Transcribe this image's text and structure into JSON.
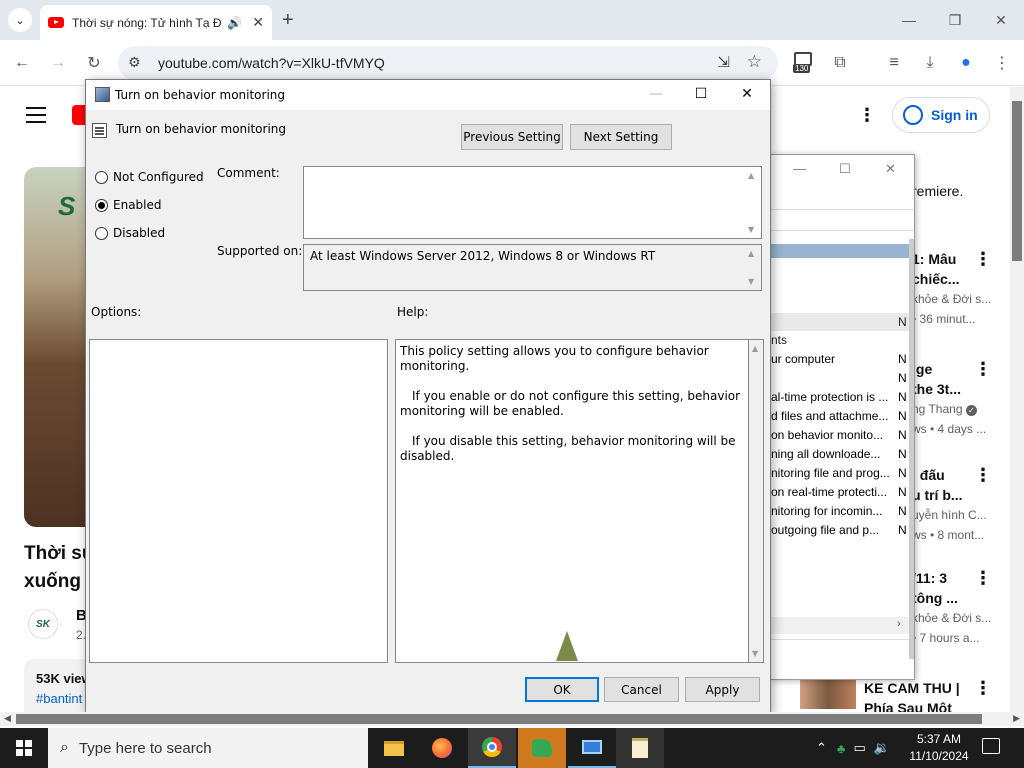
{
  "browser": {
    "tab_title": "Thời sự nóng: Tử hình Tạ Đ",
    "url": "youtube.com/watch?v=XlkU-tfVMYQ",
    "extension_badge": "130",
    "icons": [
      "chevron-down-icon",
      "youtube-favicon",
      "audio-icon",
      "close-icon",
      "plus-icon",
      "back-icon",
      "forward-icon",
      "reload-icon",
      "site-info-icon",
      "install-icon",
      "star-icon",
      "calendar-icon",
      "puzzle-icon",
      "media-icon",
      "download-icon",
      "profile-icon",
      "more-vert-icon"
    ]
  },
  "youtube": {
    "sign_in": "Sign in",
    "video_title_line1": "Thời sự",
    "video_title_line2": "xuống",
    "thumb_logo": "S",
    "channel_logo": "SK",
    "channel_initial": "B",
    "channel_sub": "2.",
    "views": "53K view",
    "hashtag": "#bantint",
    "premiere": "remiere.",
    "recs": [
      {
        "title1": "1: Mâu",
        "title2": "chiếc...",
        "meta1": "khỏe & Đời s...",
        "meta2": "• 36 minut..."
      },
      {
        "title1": "ige",
        "title2": "the 3t...",
        "meta1": "ng Thang",
        "meta2": "ws • 4 days ..."
      },
      {
        "title1": "ì đấu",
        "title2": "u trí b...",
        "meta1": "uyễn hình C...",
        "meta2": "ws • 8 mont..."
      },
      {
        "title1": "/11: 3",
        "title2": "tông ...",
        "meta1": "khỏe & Đời s...",
        "meta2": "• 7 hours a..."
      }
    ],
    "bottom_title1": "KE CAM THU |",
    "bottom_title2": "Phía Sau Một"
  },
  "gp_editor": {
    "section": "nts",
    "list": [
      {
        "text": "ur computer",
        "state": "N"
      },
      {
        "text": "",
        "state": "N"
      },
      {
        "text": "al-time protection is ...",
        "state": "N"
      },
      {
        "text": "d files and attachme...",
        "state": "N"
      },
      {
        "text": "on behavior monito...",
        "state": "N"
      },
      {
        "text": "ning all downloade...",
        "state": "N"
      },
      {
        "text": "nitoring file and prog...",
        "state": "N"
      },
      {
        "text": "on real-time protecti...",
        "state": "N"
      },
      {
        "text": "nitoring for incomin...",
        "state": "N"
      },
      {
        "text": " outgoing file and p...",
        "state": "N"
      }
    ],
    "top_state": "N"
  },
  "dialog": {
    "title": "Turn on behavior monitoring",
    "header": "Turn on behavior monitoring",
    "prev_button": "Previous Setting",
    "next_button": "Next Setting",
    "options": [
      "Not Configured",
      "Enabled",
      "Disabled"
    ],
    "selected": "Enabled",
    "comment_label": "Comment:",
    "comment_value": "",
    "supported_label": "Supported on:",
    "supported_value": "At least Windows Server 2012, Windows 8 or Windows RT",
    "options_label": "Options:",
    "help_label": "Help:",
    "help_text": [
      "This policy setting allows you to configure behavior monitoring.",
      "If you enable or do not configure this setting, behavior monitoring will be enabled.",
      "If you disable this setting, behavior monitoring will be disabled."
    ],
    "ok": "OK",
    "cancel": "Cancel",
    "apply": "Apply"
  },
  "taskbar": {
    "search_placeholder": "Type here to search",
    "time": "5:37 AM",
    "date": "11/10/2024",
    "apps": [
      "file-explorer-icon",
      "firefox-icon",
      "chrome-icon",
      "gp-editor-icon",
      "remote-icon",
      "notepad-icon"
    ]
  }
}
